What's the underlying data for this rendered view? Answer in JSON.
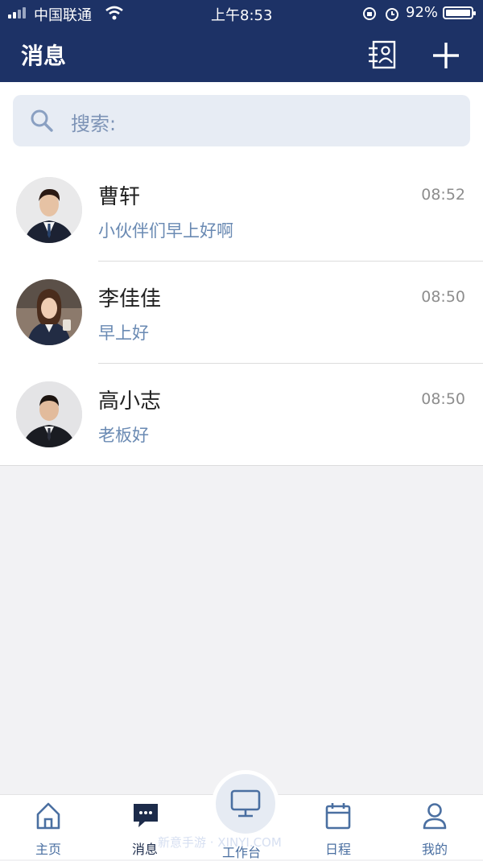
{
  "status_bar": {
    "carrier": "中国联通",
    "time": "上午8:53",
    "battery": "92%",
    "icons": [
      "signal-icon",
      "wifi-icon",
      "rotation-lock-icon",
      "alarm-icon",
      "battery-icon"
    ]
  },
  "header": {
    "title": "消息",
    "actions": [
      "contacts-icon",
      "plus-icon"
    ]
  },
  "search": {
    "placeholder": "搜索:"
  },
  "conversations": [
    {
      "name": "曹轩",
      "time": "08:52",
      "message": "小伙伴们早上好啊"
    },
    {
      "name": "李佳佳",
      "time": "08:50",
      "message": "早上好"
    },
    {
      "name": "高小志",
      "time": "08:50",
      "message": "老板好"
    }
  ],
  "tabbar": {
    "home": "主页",
    "messages": "消息",
    "workbench": "工作台",
    "schedule": "日程",
    "mine": "我的",
    "active": "messages"
  },
  "watermark": "新意手游 · XINYI.COM",
  "colors": {
    "primary": "#1d3266",
    "accent_text": "#6a8ab3",
    "search_bg": "#e7ecf4"
  }
}
